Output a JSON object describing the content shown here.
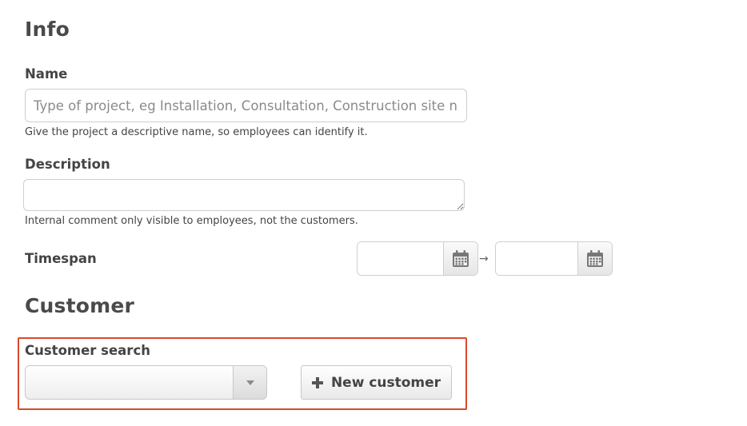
{
  "info": {
    "heading": "Info",
    "name": {
      "label": "Name",
      "value": "",
      "placeholder": "Type of project, eg Installation, Consultation, Construction site name",
      "help": "Give the project a descriptive name, so employees can identify it."
    },
    "description": {
      "label": "Description",
      "value": "",
      "help": "Internal comment only visible to employees, not the customers."
    },
    "timespan": {
      "label": "Timespan",
      "start_value": "",
      "end_value": "",
      "separator": "→",
      "calendar_icon": "calendar-icon"
    }
  },
  "customer": {
    "heading": "Customer",
    "search": {
      "label": "Customer search",
      "selected_value": "",
      "caret_icon": "caret-down-icon"
    },
    "new_button": {
      "label": "New customer",
      "icon": "plus-icon"
    },
    "highlight_color": "#d9482b"
  }
}
